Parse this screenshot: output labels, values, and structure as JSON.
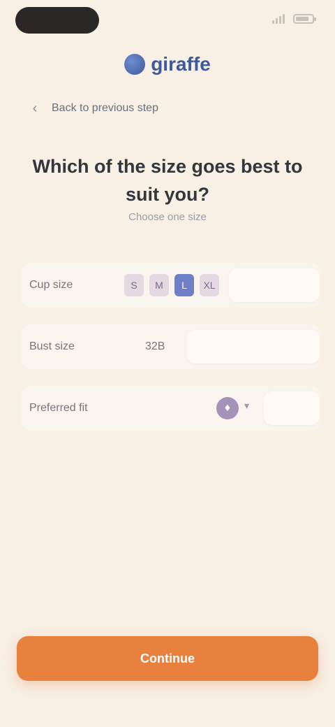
{
  "status_bar": {
    "signal_icon": "signal-icon",
    "battery_icon": "battery-icon"
  },
  "header": {
    "logo_icon": "logo-mark",
    "logo_text": "giraffe"
  },
  "back": {
    "icon": "chevron-left-icon",
    "glyph": "‹",
    "label": "Back to previous step"
  },
  "intro": {
    "title": "Which of the size goes best to",
    "title_line2": "suit you?",
    "subtitle": "Choose one size"
  },
  "form": {
    "size_label": "Cup size",
    "size_options": [
      "S",
      "M",
      "L",
      "XL"
    ],
    "size_selected_index": 2,
    "bust_label": "Bust size",
    "bust_value": "32B",
    "preference_label": "Preferred fit",
    "preference_icon_glyph": "♦",
    "preference_caret": "▾"
  },
  "cta": {
    "label": "Continue"
  },
  "colors": {
    "background": "#f8efe5",
    "accent": "#e8813e",
    "brand": "#3d5a9c",
    "selected": "#6e7fc7"
  }
}
